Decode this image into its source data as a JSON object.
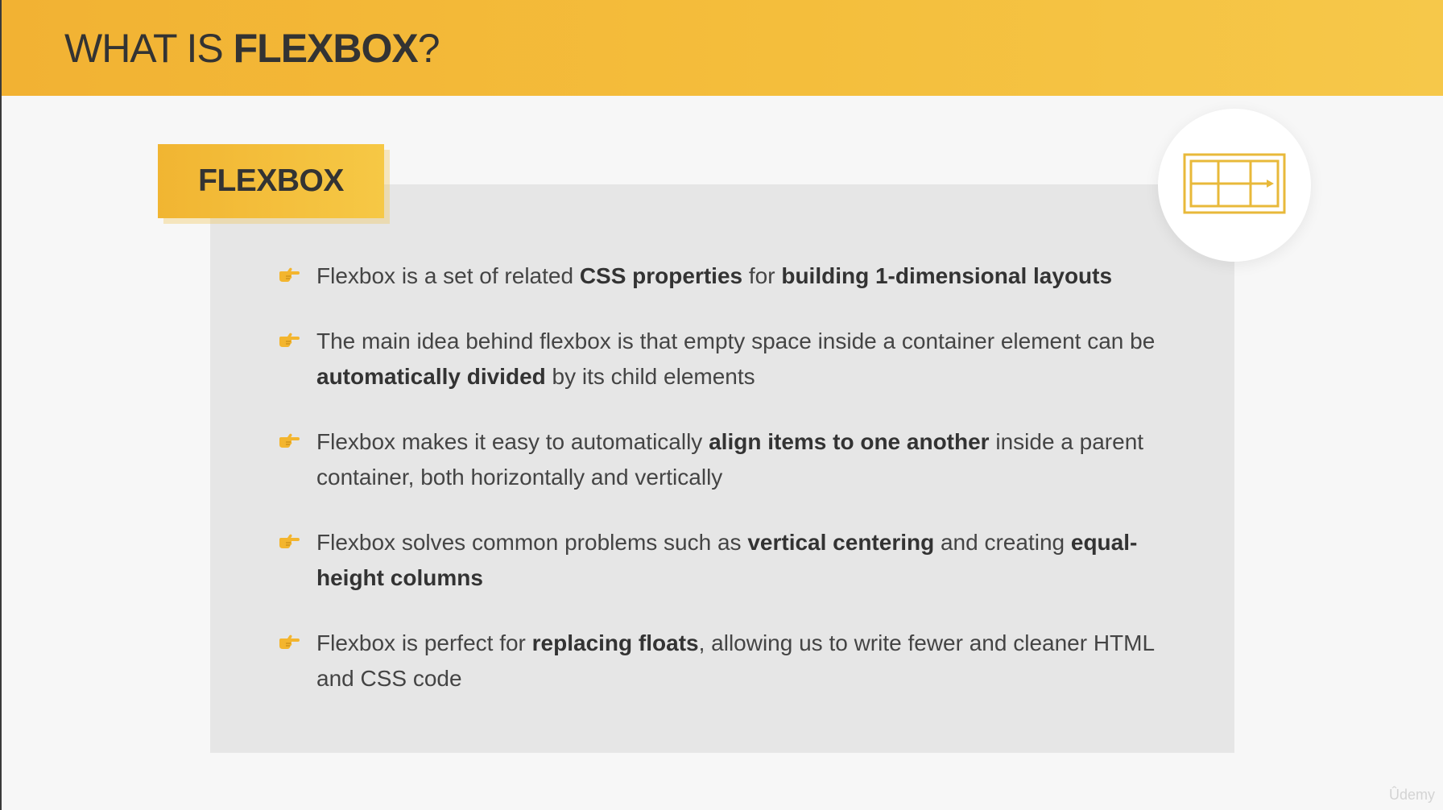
{
  "header": {
    "title_prefix": "WHAT IS ",
    "title_bold": "FLEXBOX",
    "title_suffix": "?"
  },
  "tag": {
    "label": "FLEXBOX"
  },
  "icon": {
    "name": "flex-layout-icon",
    "color": "#e8b93a"
  },
  "bullets": [
    {
      "icon": "pointing-hand-icon",
      "parts": [
        {
          "text": "Flexbox is a set of related ",
          "bold": false
        },
        {
          "text": "CSS properties",
          "bold": true
        },
        {
          "text": " for ",
          "bold": false
        },
        {
          "text": "building 1-dimensional layouts",
          "bold": true
        }
      ]
    },
    {
      "icon": "pointing-hand-icon",
      "parts": [
        {
          "text": "The main idea behind flexbox is that empty space inside a container element can be ",
          "bold": false
        },
        {
          "text": "automatically divided",
          "bold": true
        },
        {
          "text": " by its child elements",
          "bold": false
        }
      ]
    },
    {
      "icon": "pointing-hand-icon",
      "parts": [
        {
          "text": "Flexbox makes it easy to automatically ",
          "bold": false
        },
        {
          "text": "align items to one another",
          "bold": true
        },
        {
          "text": " inside a parent container, both horizontally and vertically",
          "bold": false
        }
      ]
    },
    {
      "icon": "pointing-hand-icon",
      "parts": [
        {
          "text": "Flexbox solves common problems such as ",
          "bold": false
        },
        {
          "text": "vertical centering",
          "bold": true
        },
        {
          "text": " and creating ",
          "bold": false
        },
        {
          "text": "equal-height columns",
          "bold": true
        }
      ]
    },
    {
      "icon": "pointing-hand-icon",
      "parts": [
        {
          "text": "Flexbox is perfect for ",
          "bold": false
        },
        {
          "text": "replacing floats",
          "bold": true
        },
        {
          "text": ", allowing us to write fewer and cleaner HTML and CSS code",
          "bold": false
        }
      ]
    }
  ],
  "watermark": "Ûdemy",
  "colors": {
    "accent": "#f4bb3a",
    "text": "#444444",
    "panel": "#e6e6e6",
    "background": "#f7f7f7"
  }
}
